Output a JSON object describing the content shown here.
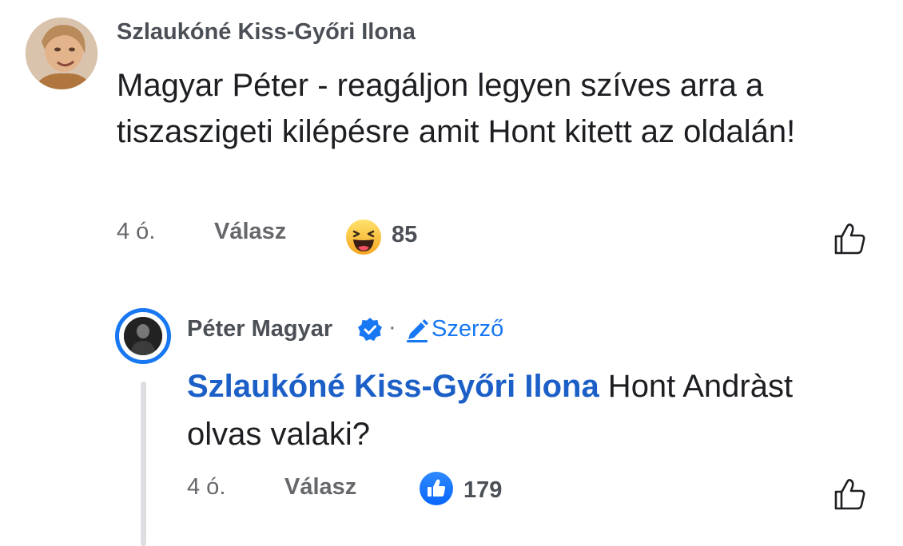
{
  "comment": {
    "author": "Szlaukóné Kiss-Győri Ilona",
    "text": "Magyar Péter - reagáljon legyen szíves arra a tiszaszigeti kilépésre amit Hont kitett az oldalán!",
    "time": "4 ó.",
    "reply_label": "Válasz",
    "reaction_icon": "haha-emoji",
    "reaction_count": "85"
  },
  "reply": {
    "author": "Péter Magyar",
    "verified_icon": "verified-badge-icon",
    "separator": "·",
    "author_badge": "Szerző",
    "mention": "Szlaukóné Kiss-Győri Ilona",
    "text": " Hont Andràst olvas valaki?",
    "time": "4 ó.",
    "reply_label": "Válasz",
    "reaction_icon": "like-thumb",
    "reaction_count": "179"
  },
  "colors": {
    "accent": "#1877f2",
    "mention": "#1b5fc7",
    "meta": "#65676b",
    "thread_line": "#dcdee2"
  }
}
